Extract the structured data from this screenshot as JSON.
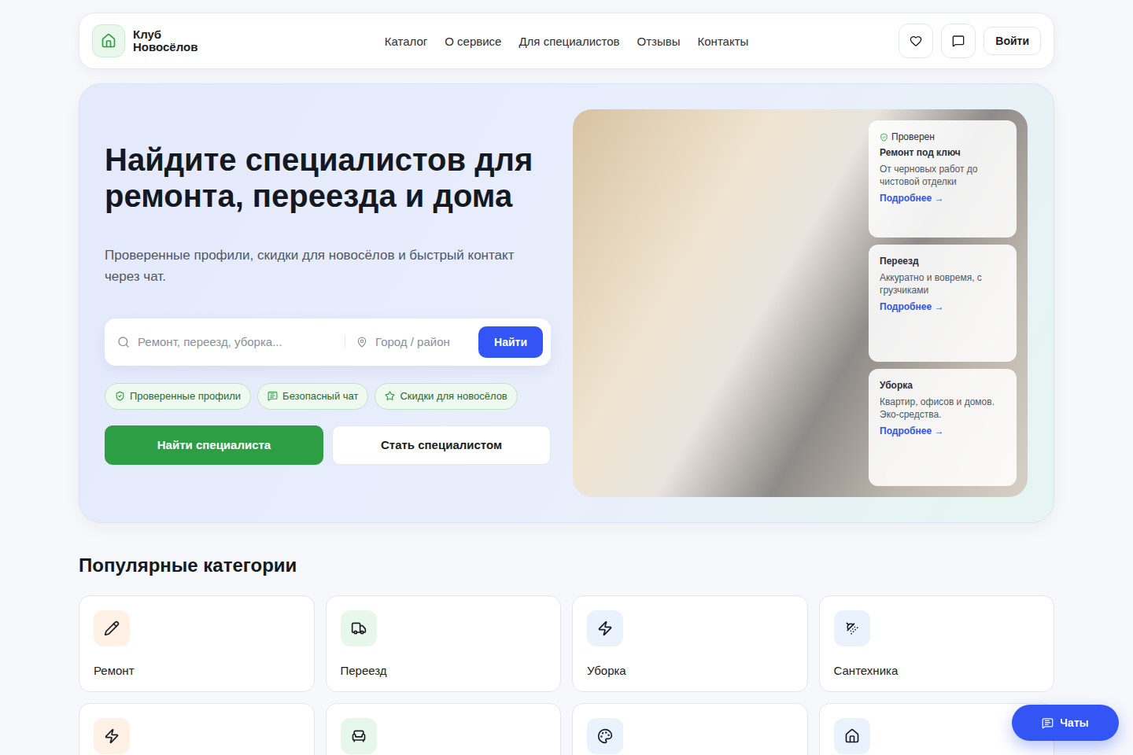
{
  "header": {
    "logo_lines": [
      "Клуб",
      "Новосёлов"
    ],
    "nav": [
      "Каталог",
      "О сервисе",
      "Для специалистов",
      "Отзывы",
      "Контакты"
    ],
    "login": "Войти"
  },
  "hero": {
    "title": "Найдите специалистов для ремонта, переезда и дома",
    "subtitle": "Проверенные профили, скидки для новосёлов и быстрый контакт через чат.",
    "search": {
      "query_placeholder": "Ремонт, переезд, уборка...",
      "location_placeholder": "Город / район",
      "button": "Найти"
    },
    "chips": [
      "Проверенные профили",
      "Безопасный чат",
      "Скидки для новосёлов"
    ],
    "primary_button": "Найти специалиста",
    "secondary_button": "Стать специалистом",
    "cards": [
      {
        "badge": "Проверен",
        "title": "Ремонт под ключ",
        "description": "От черновых работ до чистовой отделки",
        "link": "Подробнее →"
      },
      {
        "badge": null,
        "title": "Переезд",
        "description": "Аккуратно и вовремя, с грузчиками",
        "link": "Подробнее →"
      },
      {
        "badge": null,
        "title": "Уборка",
        "description": "Квартир, офисов и домов. Эко-средства.",
        "link": "Подробнее →"
      }
    ]
  },
  "categories": {
    "title": "Популярные категории",
    "items": [
      {
        "label": "Ремонт",
        "color": "#fff1e6"
      },
      {
        "label": "Переезд",
        "color": "#e8f7ec"
      },
      {
        "label": "Уборка",
        "color": "#eaf2fd"
      },
      {
        "label": "Сантехника",
        "color": "#eaf2fd"
      },
      {
        "label": "",
        "color": "#fff1e6"
      },
      {
        "label": "",
        "color": "#e8f7ec"
      },
      {
        "label": "",
        "color": "#eaf2fd"
      },
      {
        "label": "",
        "color": "#eaf2fd"
      }
    ]
  },
  "chat_button": "Чаты"
}
